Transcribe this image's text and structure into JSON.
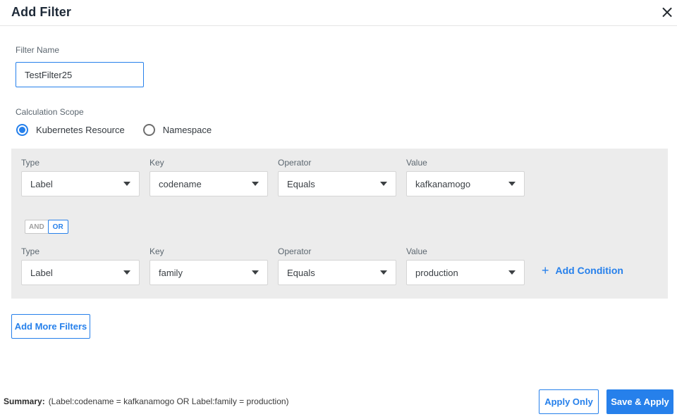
{
  "header": {
    "title": "Add Filter",
    "close_icon": "×"
  },
  "filter_name": {
    "label": "Filter Name",
    "value": "TestFilter25"
  },
  "calculation_scope": {
    "label": "Calculation Scope",
    "options": [
      {
        "label": "Kubernetes Resource",
        "selected": true
      },
      {
        "label": "Namespace",
        "selected": false
      }
    ]
  },
  "conditions": {
    "rows": [
      {
        "fields": [
          {
            "label": "Type",
            "value": "Label"
          },
          {
            "label": "Key",
            "value": "codename"
          },
          {
            "label": "Operator",
            "value": "Equals"
          },
          {
            "label": "Value",
            "value": "kafkanamogo"
          }
        ]
      },
      {
        "fields": [
          {
            "label": "Type",
            "value": "Label"
          },
          {
            "label": "Key",
            "value": "family"
          },
          {
            "label": "Operator",
            "value": "Equals"
          },
          {
            "label": "Value",
            "value": "production"
          }
        ]
      }
    ],
    "logic_toggle": {
      "and_label": "AND",
      "or_label": "OR",
      "selected": "OR"
    },
    "add_condition": {
      "plus_icon": "+",
      "label": "Add Condition"
    }
  },
  "add_more_filters_label": "Add More Filters",
  "footer": {
    "summary_label": "Summary:",
    "summary_text": "(Label:codename = kafkanamogo OR Label:family = production)",
    "apply_only_label": "Apply Only",
    "save_apply_label": "Save & Apply"
  },
  "colors": {
    "accent_blue": "#2680eb",
    "panel_gray": "#ececec",
    "border_gray": "#d5d5d5"
  }
}
